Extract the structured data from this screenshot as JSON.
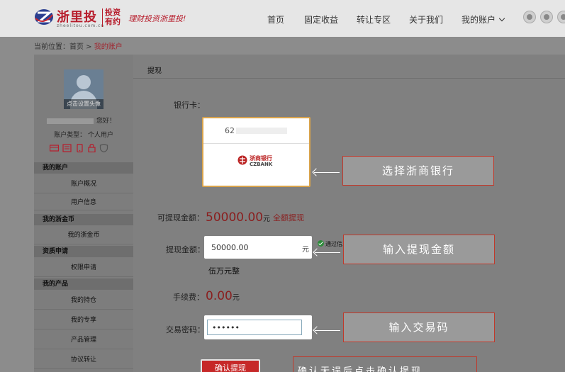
{
  "header": {
    "logo_name": "浙里投",
    "logo_sub": "zheelitou.com.cn",
    "logo_tag": "投资有约",
    "slogan": "理财投资浙里投!",
    "nav": [
      {
        "label": "首页"
      },
      {
        "label": "固定收益"
      },
      {
        "label": "转让专区"
      },
      {
        "label": "关于我们"
      },
      {
        "label": "我的账户"
      }
    ],
    "social_icons": [
      "wechat-icon",
      "apple-icon",
      "android-icon"
    ]
  },
  "breadcrumb": {
    "prefix": "当前位置：首页 > ",
    "current": "我的账户"
  },
  "sidebar": {
    "avatar_caption": "点击设置头像",
    "greeting": "您好！",
    "account_type": "账户类型： 个人用户",
    "icons": [
      "id-card-icon",
      "document-icon",
      "phone-icon",
      "lock-icon",
      "shield-icon"
    ],
    "sections": [
      {
        "title": "我的账户",
        "items": [
          "账户概况",
          "用户信息"
        ]
      },
      {
        "title": "我的浙金币",
        "items": [
          "我的浙金币"
        ]
      },
      {
        "title": "资质申请",
        "items": [
          "权限申请"
        ]
      },
      {
        "title": "我的产品",
        "items": [
          "我的持仓",
          "我的专享",
          "产品管理",
          "协议转让"
        ]
      }
    ]
  },
  "main": {
    "tab": "提现",
    "bank_card_label": "银行卡：",
    "card_number_prefix": "62",
    "bank_name": "浙商银行",
    "bank_name_en": "CZBANK",
    "available_label": "可提现金额：",
    "available_amount": "50000.00",
    "currency_unit": "元",
    "withdraw_all": "全额提现",
    "amount_label": "提现金额：",
    "amount_value": "50000.00",
    "amount_unit": "元",
    "verify_text": "通过信息验证！",
    "amount_cn": "伍万元整",
    "fee_label": "手续费：",
    "fee_amount": "0.00",
    "fee_unit": "元",
    "password_label": "交易密码：",
    "password_value": "••••••",
    "submit_label": "确认提现"
  },
  "annotations": {
    "select_bank": "选择浙商银行",
    "enter_amount": "输入提现金额",
    "enter_code": "输入交易码",
    "confirm_hint": "确认无误后点击确认提现"
  }
}
